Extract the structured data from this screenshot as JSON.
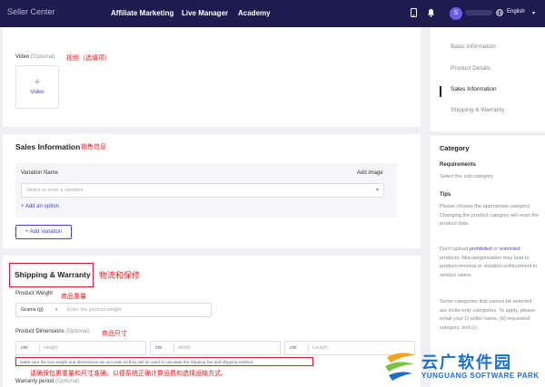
{
  "topbar": {
    "brand": "Seller Center",
    "nav": [
      "Affiliate Marketing",
      "Live Manager",
      "Academy"
    ],
    "avatar_initial": "S",
    "language": "English",
    "icons": [
      "phone-icon",
      "bell-icon",
      "chevron-down-icon"
    ]
  },
  "video": {
    "label": "Video",
    "optional": "(Optional)",
    "annotation": "视频（选填项）",
    "upload_label": "Video",
    "upload_icon": "+"
  },
  "sales": {
    "title": "Sales Information",
    "annotation": "销售信息",
    "variation_name_label": "Variation Name",
    "add_image": "Add image",
    "select_placeholder": "Select or enter a variation",
    "add_option": "+ Add an option",
    "add_variation": "+ Add Variation"
  },
  "shipping": {
    "title": "Shipping & Warranty",
    "annotation": "物流和保修",
    "product_weight_label": "Product Weight",
    "weight_annotation": "商品重量",
    "weight_unit": "Grams (g)",
    "weight_placeholder": "Enter the product weight",
    "dimensions_label": "Product Dimensions",
    "dimensions_optional": "(Optional)",
    "dimensions_annotation": "商品尺寸",
    "dims": [
      {
        "unit": "cm",
        "placeholder": "Height"
      },
      {
        "unit": "cm",
        "placeholder": "Width"
      },
      {
        "unit": "cm",
        "placeholder": "Length"
      }
    ],
    "warning": "Make sure the box weight and dimensions are accurate as they will be used to calculate the shipping fee and shipping method.",
    "warning_annotation": "请确保包裹重量和尺寸准确，以便系统正确计算运费和选择运输方式。",
    "warranty_label": "Warranty period",
    "warranty_optional": "(Optional)"
  },
  "steps": [
    "Basic information",
    "Product Details",
    "Sales Information",
    "Shipping & Warranty"
  ],
  "help": {
    "title": "Category",
    "requirements_h": "Requirements",
    "requirements_p": "Select the sub-category.",
    "tips_h": "Tips",
    "tips_p1": "Please choose the appropriate category. Changing the product category will reset the product data.",
    "tips_p2_a": "Don't upload",
    "tips_p2_kw1": "prohibited",
    "tips_p2_b": "or",
    "tips_p2_kw2": "restricted",
    "tips_p2_c": "products. Miscategorisation may lead to product removal or violation enforcement in serious cases.",
    "tips_p3": "Some categories that cannot be selected are invite-only categories. To apply, please email your (2 seller name, (b) requested category, and (c)"
  },
  "watermark": {
    "title": "云广软件园",
    "subtitle": "YUNGUANG SOFTWARE PARK"
  },
  "colors": {
    "nav_bg": "#1e1c4e",
    "accent": "#4a3fc8",
    "annotation_red": "#e02020",
    "watermark_blue": "#1d6fc9"
  }
}
